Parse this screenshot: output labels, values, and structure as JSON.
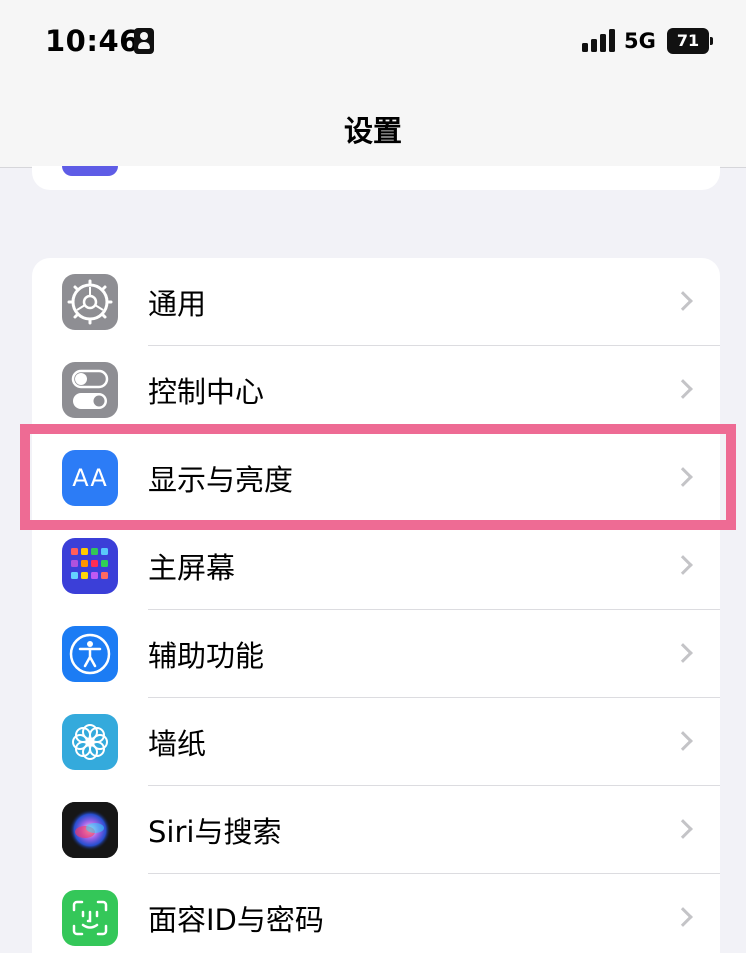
{
  "status_bar": {
    "time": "10:46",
    "network": "5G",
    "battery": "71"
  },
  "nav": {
    "title": "设置"
  },
  "settings": {
    "items": [
      {
        "label": "通用",
        "icon": "gear-icon"
      },
      {
        "label": "控制中心",
        "icon": "toggles-icon"
      },
      {
        "label": "显示与亮度",
        "icon": "text-size-icon",
        "icon_text": "AA"
      },
      {
        "label": "主屏幕",
        "icon": "app-grid-icon"
      },
      {
        "label": "辅助功能",
        "icon": "accessibility-icon"
      },
      {
        "label": "墙纸",
        "icon": "flower-icon"
      },
      {
        "label": "Siri与搜索",
        "icon": "siri-icon"
      },
      {
        "label": "面容ID与密码",
        "icon": "face-id-icon"
      }
    ]
  },
  "colors": {
    "highlight": "#ee6b94",
    "background": "#f2f2f7",
    "display_icon": "#2c7cf6"
  }
}
